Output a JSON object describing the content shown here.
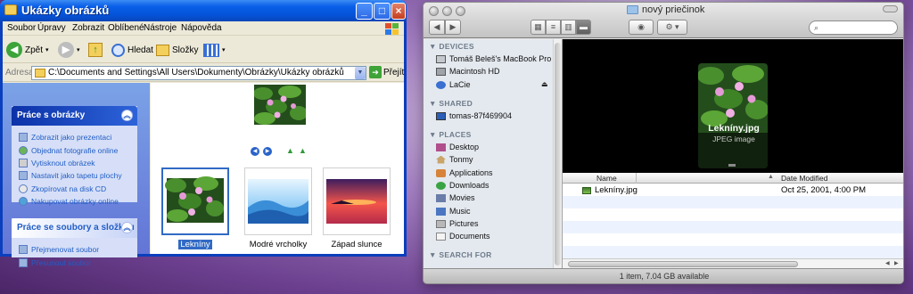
{
  "xp": {
    "title": "Ukázky obrázků",
    "menu": [
      "Soubor",
      "Úpravy",
      "Zobrazit",
      "Oblíbené",
      "Nástroje",
      "Nápověda"
    ],
    "toolbar": {
      "back": "Zpět",
      "search": "Hledat",
      "folders": "Složky"
    },
    "address": {
      "label": "Adresa",
      "path": "C:\\Documents and Settings\\All Users\\Dokumenty\\Obrázky\\Ukázky obrázků",
      "go": "Přejít"
    },
    "tasks": {
      "picture_tasks": {
        "title": "Práce s obrázky",
        "items": [
          "Zobrazit jako prezentaci",
          "Objednat fotografie online",
          "Vytisknout obrázek",
          "Nastavit jako tapetu plochy",
          "Zkopírovat na disk CD",
          "Nakupovat obrázky online"
        ]
      },
      "file_tasks": {
        "title": "Práce se soubory a složkou",
        "items": [
          "Přejmenovat soubor",
          "Přesunout soubor"
        ]
      }
    },
    "thumbnails": [
      {
        "label": "Lekníny",
        "selected": true
      },
      {
        "label": "Modré vrcholky",
        "selected": false
      },
      {
        "label": "Západ slunce",
        "selected": false
      }
    ]
  },
  "finder": {
    "title": "nový priečinok",
    "search_placeholder": "",
    "sidebar": {
      "devices_label": "DEVICES",
      "devices": [
        "Tomáš Beleš's MacBook Pro",
        "Macintosh HD",
        "LaCie"
      ],
      "shared_label": "SHARED",
      "shared": [
        "tomas-87f469904"
      ],
      "places_label": "PLACES",
      "places": [
        "Desktop",
        "Tonmy",
        "Applications",
        "Downloads",
        "Movies",
        "Music",
        "Pictures",
        "Documents"
      ],
      "search_label": "SEARCH FOR"
    },
    "coverflow": {
      "name": "Lekníny.jpg",
      "kind": "JPEG image"
    },
    "columns": {
      "name": "Name",
      "date": "Date Modified"
    },
    "files": [
      {
        "name": "Lekníny.jpg",
        "date": "Oct 25, 2001, 4:00 PM"
      }
    ],
    "status": "1 item, 7.04 GB available"
  }
}
